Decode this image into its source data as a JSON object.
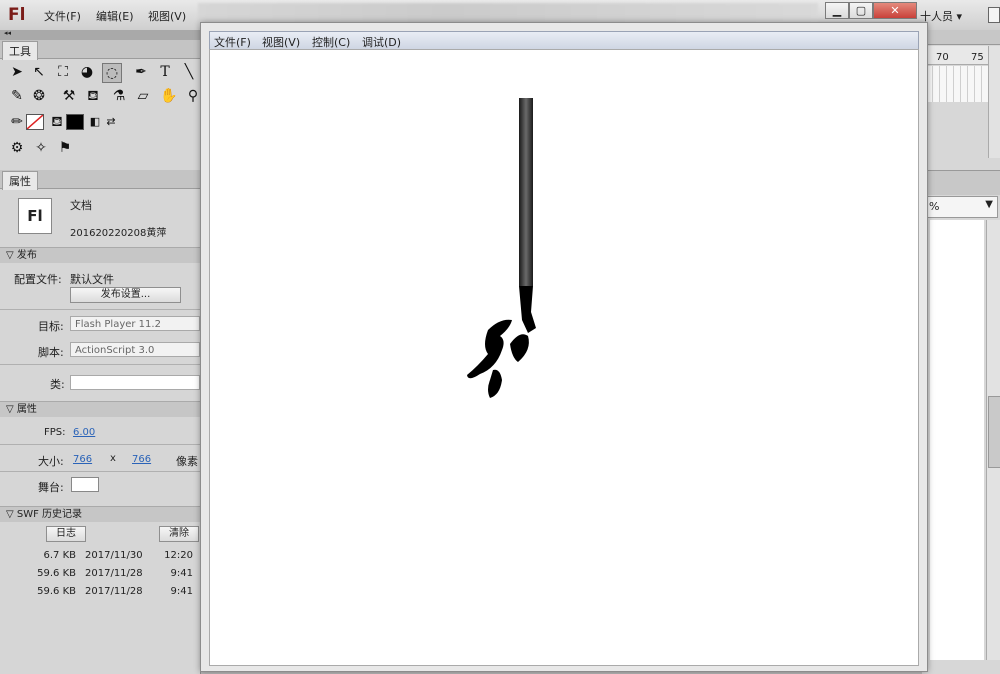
{
  "app": {
    "logo": "Fl",
    "menu": [
      "文件(F)",
      "编辑(E)",
      "视图(V)"
    ],
    "workspace": "十人员"
  },
  "tools_panel": {
    "tab": "工具"
  },
  "properties": {
    "tab": "属性",
    "doc_icon": "Fl",
    "doc_type": "文档",
    "doc_name": "201620220208黄萍",
    "publish_section": "发布",
    "profile_label": "配置文件:",
    "profile_value": "默认文件",
    "publish_settings_button": "发布设置...",
    "target_label": "目标:",
    "target_value": "Flash Player 11.2",
    "script_label": "脚本:",
    "script_value": "ActionScript 3.0",
    "class_label": "类:",
    "class_value": "",
    "props_section": "属性",
    "fps_label": "FPS:",
    "fps_value": "6.00",
    "size_label": "大小:",
    "width_value": "766",
    "x_label": "x",
    "height_value": "766",
    "unit_label": "像素",
    "stage_label": "舞台:",
    "stage_color": "#ffffff",
    "swf_section": "SWF 历史记录",
    "log_button": "日志",
    "clear_button": "清除",
    "history": [
      {
        "size": "6.7 KB",
        "date": "2017/11/30",
        "time": "12:20"
      },
      {
        "size": "59.6 KB",
        "date": "2017/11/28",
        "time": "9:41"
      },
      {
        "size": "59.6 KB",
        "date": "2017/11/28",
        "time": "9:41"
      }
    ]
  },
  "timeline": {
    "frame_labels": [
      "70",
      "75"
    ]
  },
  "right_panel": {
    "zoom_symbol": "%"
  },
  "swf_window": {
    "menu": [
      "文件(F)",
      "视图(V)",
      "控制(C)",
      "调试(D)"
    ]
  },
  "colors": {
    "brand": "#7a1c18",
    "link": "#2a63b8",
    "window_close": "#c9413a"
  }
}
